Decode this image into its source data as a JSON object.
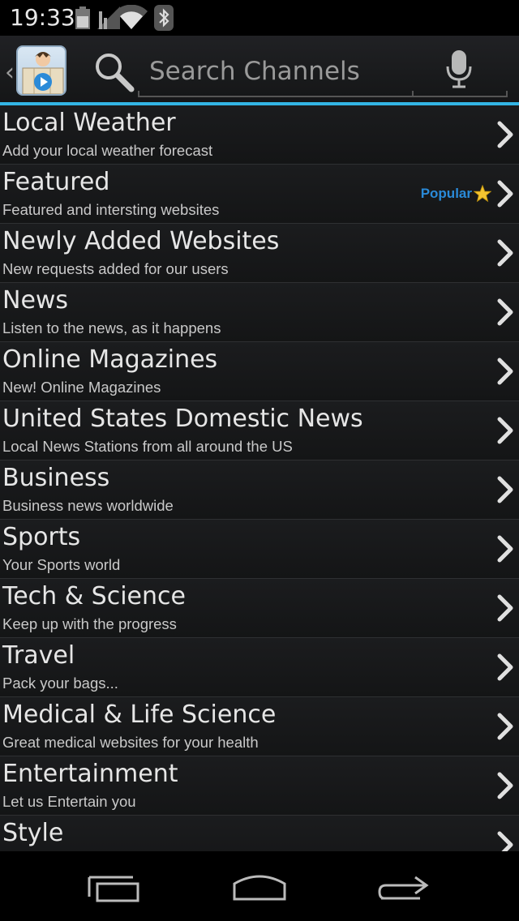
{
  "status_bar": {
    "time": "19:33",
    "icons": [
      "battery-icon",
      "signal-icon",
      "wifi-icon",
      "bluetooth-icon"
    ]
  },
  "header": {
    "back_icon": "chevron-left-icon",
    "logo": "app-logo",
    "search": {
      "placeholder": "Search Channels",
      "value": ""
    },
    "mic_icon": "microphone-icon",
    "accent_color": "#33b5e5"
  },
  "categories": [
    {
      "title": "Local Weather",
      "subtitle": "Add your local weather forecast",
      "badge": ""
    },
    {
      "title": "Featured",
      "subtitle": "Featured and intersting websites",
      "badge": "Popular"
    },
    {
      "title": "Newly Added Websites",
      "subtitle": "New requests added for our users",
      "badge": ""
    },
    {
      "title": "News",
      "subtitle": "Listen to the news, as it happens",
      "badge": ""
    },
    {
      "title": "Online Magazines",
      "subtitle": "New! Online Magazines",
      "badge": ""
    },
    {
      "title": "United States Domestic News",
      "subtitle": "Local News Stations from all around the US",
      "badge": ""
    },
    {
      "title": "Business",
      "subtitle": "Business news worldwide",
      "badge": ""
    },
    {
      "title": "Sports",
      "subtitle": "Your Sports world",
      "badge": ""
    },
    {
      "title": "Tech & Science",
      "subtitle": "Keep up with the progress",
      "badge": ""
    },
    {
      "title": "Travel",
      "subtitle": "Pack your bags...",
      "badge": ""
    },
    {
      "title": "Medical & Life Science",
      "subtitle": "Great medical websites for your health",
      "badge": ""
    },
    {
      "title": "Entertainment",
      "subtitle": "Let us Entertain you",
      "badge": ""
    },
    {
      "title": "Style",
      "subtitle": "",
      "badge": ""
    }
  ],
  "nav_bar": {
    "buttons": [
      "recent-apps-icon",
      "home-icon",
      "back-icon"
    ]
  }
}
